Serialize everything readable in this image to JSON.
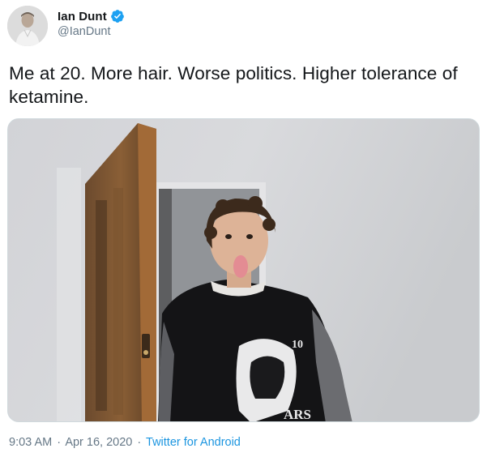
{
  "author": {
    "display_name": "Ian Dunt",
    "handle": "@IanDunt",
    "verified": true,
    "avatar_icon": "profile-photo"
  },
  "tweet": {
    "text": "Me at 20. More hair. Worse politics. Higher tolerance of ketamine."
  },
  "media": {
    "shirt_number": "10",
    "shirt_text": "ARS"
  },
  "meta": {
    "time": "9:03 AM",
    "separator": "·",
    "date": "Apr 16, 2020",
    "source": "Twitter for Android"
  },
  "colors": {
    "text": "#14171a",
    "secondary": "#657786",
    "link": "#1b95e0",
    "verified": "#1da1f2"
  }
}
